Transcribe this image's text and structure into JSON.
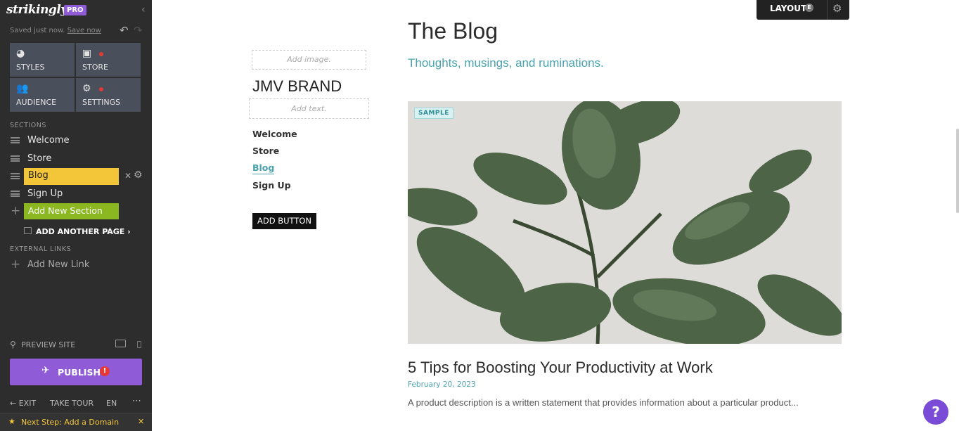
{
  "sidebar": {
    "logo": "strikingly",
    "pro_badge": "PRO",
    "saved_text": "Saved just now.",
    "save_now": "Save now",
    "tiles": [
      {
        "label": "STYLES",
        "icon": "palette-icon"
      },
      {
        "label": "STORE",
        "icon": "shopping-bag-icon",
        "alert": true
      },
      {
        "label": "AUDIENCE",
        "icon": "people-icon"
      },
      {
        "label": "SETTINGS",
        "icon": "gear-icon",
        "alert": true
      }
    ],
    "sections_heading": "SECTIONS",
    "sections": [
      "Welcome",
      "Store",
      "Blog",
      "Sign Up"
    ],
    "add_new_section": "Add New Section",
    "add_another_page": "ADD ANOTHER PAGE",
    "external_links_heading": "EXTERNAL LINKS",
    "add_new_link": "Add New Link",
    "preview_site": "PREVIEW SITE",
    "publish": "PUBLISH",
    "publish_alert": "!",
    "exit": "EXIT",
    "take_tour": "TAKE TOUR",
    "language": "EN",
    "next_step": "Next Step: Add a Domain",
    "colors": {
      "accent": "#8f5bd6",
      "highlight": "#f3c63a",
      "add_green": "#8bb820"
    }
  },
  "site": {
    "add_image": "Add image.",
    "brand": "JMV BRAND",
    "add_text": "Add text.",
    "nav": [
      "Welcome",
      "Store",
      "Blog",
      "Sign Up"
    ],
    "nav_active": "Blog",
    "add_button": "ADD BUTTON"
  },
  "toolbar": {
    "layout": "LAYOUT",
    "layout_badge": "E"
  },
  "blog": {
    "title": "The Blog",
    "subtitle": "Thoughts, musings, and ruminations.",
    "sample_badge": "SAMPLE",
    "post_title": "5 Tips for Boosting Your Productivity at Work",
    "post_date": "February 20, 2023",
    "post_desc": "A product description is a written statement that provides information about a particular product...",
    "accent": "#4aa3ad"
  },
  "help": "?"
}
